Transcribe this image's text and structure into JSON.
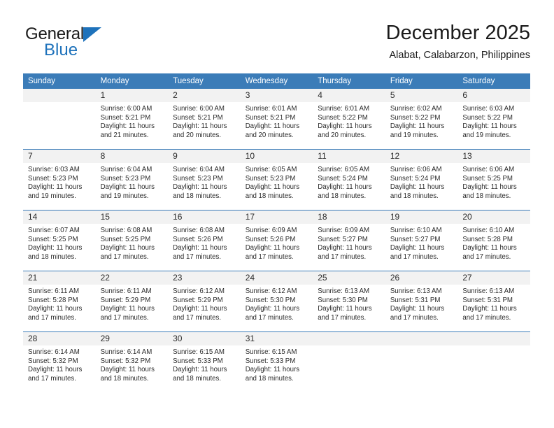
{
  "brand": {
    "name_top": "General",
    "name_bottom": "Blue",
    "accent_color": "#1e72bb",
    "triangle_icon": "triangle-icon"
  },
  "header": {
    "title": "December 2025",
    "subtitle": "Alabat, Calabarzon, Philippines"
  },
  "theme": {
    "header_bg": "#3b7cb8",
    "daynum_bg": "#f2f2f2",
    "row_divider": "#3b7cb8",
    "text": "#2b2b2b"
  },
  "weekdays": [
    "Sunday",
    "Monday",
    "Tuesday",
    "Wednesday",
    "Thursday",
    "Friday",
    "Saturday"
  ],
  "weeks": [
    [
      {
        "day": "",
        "lines": [
          "",
          "",
          "",
          ""
        ]
      },
      {
        "day": "1",
        "lines": [
          "Sunrise: 6:00 AM",
          "Sunset: 5:21 PM",
          "Daylight: 11 hours",
          "and 21 minutes."
        ]
      },
      {
        "day": "2",
        "lines": [
          "Sunrise: 6:00 AM",
          "Sunset: 5:21 PM",
          "Daylight: 11 hours",
          "and 20 minutes."
        ]
      },
      {
        "day": "3",
        "lines": [
          "Sunrise: 6:01 AM",
          "Sunset: 5:21 PM",
          "Daylight: 11 hours",
          "and 20 minutes."
        ]
      },
      {
        "day": "4",
        "lines": [
          "Sunrise: 6:01 AM",
          "Sunset: 5:22 PM",
          "Daylight: 11 hours",
          "and 20 minutes."
        ]
      },
      {
        "day": "5",
        "lines": [
          "Sunrise: 6:02 AM",
          "Sunset: 5:22 PM",
          "Daylight: 11 hours",
          "and 19 minutes."
        ]
      },
      {
        "day": "6",
        "lines": [
          "Sunrise: 6:03 AM",
          "Sunset: 5:22 PM",
          "Daylight: 11 hours",
          "and 19 minutes."
        ]
      }
    ],
    [
      {
        "day": "7",
        "lines": [
          "Sunrise: 6:03 AM",
          "Sunset: 5:23 PM",
          "Daylight: 11 hours",
          "and 19 minutes."
        ]
      },
      {
        "day": "8",
        "lines": [
          "Sunrise: 6:04 AM",
          "Sunset: 5:23 PM",
          "Daylight: 11 hours",
          "and 19 minutes."
        ]
      },
      {
        "day": "9",
        "lines": [
          "Sunrise: 6:04 AM",
          "Sunset: 5:23 PM",
          "Daylight: 11 hours",
          "and 18 minutes."
        ]
      },
      {
        "day": "10",
        "lines": [
          "Sunrise: 6:05 AM",
          "Sunset: 5:23 PM",
          "Daylight: 11 hours",
          "and 18 minutes."
        ]
      },
      {
        "day": "11",
        "lines": [
          "Sunrise: 6:05 AM",
          "Sunset: 5:24 PM",
          "Daylight: 11 hours",
          "and 18 minutes."
        ]
      },
      {
        "day": "12",
        "lines": [
          "Sunrise: 6:06 AM",
          "Sunset: 5:24 PM",
          "Daylight: 11 hours",
          "and 18 minutes."
        ]
      },
      {
        "day": "13",
        "lines": [
          "Sunrise: 6:06 AM",
          "Sunset: 5:25 PM",
          "Daylight: 11 hours",
          "and 18 minutes."
        ]
      }
    ],
    [
      {
        "day": "14",
        "lines": [
          "Sunrise: 6:07 AM",
          "Sunset: 5:25 PM",
          "Daylight: 11 hours",
          "and 18 minutes."
        ]
      },
      {
        "day": "15",
        "lines": [
          "Sunrise: 6:08 AM",
          "Sunset: 5:25 PM",
          "Daylight: 11 hours",
          "and 17 minutes."
        ]
      },
      {
        "day": "16",
        "lines": [
          "Sunrise: 6:08 AM",
          "Sunset: 5:26 PM",
          "Daylight: 11 hours",
          "and 17 minutes."
        ]
      },
      {
        "day": "17",
        "lines": [
          "Sunrise: 6:09 AM",
          "Sunset: 5:26 PM",
          "Daylight: 11 hours",
          "and 17 minutes."
        ]
      },
      {
        "day": "18",
        "lines": [
          "Sunrise: 6:09 AM",
          "Sunset: 5:27 PM",
          "Daylight: 11 hours",
          "and 17 minutes."
        ]
      },
      {
        "day": "19",
        "lines": [
          "Sunrise: 6:10 AM",
          "Sunset: 5:27 PM",
          "Daylight: 11 hours",
          "and 17 minutes."
        ]
      },
      {
        "day": "20",
        "lines": [
          "Sunrise: 6:10 AM",
          "Sunset: 5:28 PM",
          "Daylight: 11 hours",
          "and 17 minutes."
        ]
      }
    ],
    [
      {
        "day": "21",
        "lines": [
          "Sunrise: 6:11 AM",
          "Sunset: 5:28 PM",
          "Daylight: 11 hours",
          "and 17 minutes."
        ]
      },
      {
        "day": "22",
        "lines": [
          "Sunrise: 6:11 AM",
          "Sunset: 5:29 PM",
          "Daylight: 11 hours",
          "and 17 minutes."
        ]
      },
      {
        "day": "23",
        "lines": [
          "Sunrise: 6:12 AM",
          "Sunset: 5:29 PM",
          "Daylight: 11 hours",
          "and 17 minutes."
        ]
      },
      {
        "day": "24",
        "lines": [
          "Sunrise: 6:12 AM",
          "Sunset: 5:30 PM",
          "Daylight: 11 hours",
          "and 17 minutes."
        ]
      },
      {
        "day": "25",
        "lines": [
          "Sunrise: 6:13 AM",
          "Sunset: 5:30 PM",
          "Daylight: 11 hours",
          "and 17 minutes."
        ]
      },
      {
        "day": "26",
        "lines": [
          "Sunrise: 6:13 AM",
          "Sunset: 5:31 PM",
          "Daylight: 11 hours",
          "and 17 minutes."
        ]
      },
      {
        "day": "27",
        "lines": [
          "Sunrise: 6:13 AM",
          "Sunset: 5:31 PM",
          "Daylight: 11 hours",
          "and 17 minutes."
        ]
      }
    ],
    [
      {
        "day": "28",
        "lines": [
          "Sunrise: 6:14 AM",
          "Sunset: 5:32 PM",
          "Daylight: 11 hours",
          "and 17 minutes."
        ]
      },
      {
        "day": "29",
        "lines": [
          "Sunrise: 6:14 AM",
          "Sunset: 5:32 PM",
          "Daylight: 11 hours",
          "and 18 minutes."
        ]
      },
      {
        "day": "30",
        "lines": [
          "Sunrise: 6:15 AM",
          "Sunset: 5:33 PM",
          "Daylight: 11 hours",
          "and 18 minutes."
        ]
      },
      {
        "day": "31",
        "lines": [
          "Sunrise: 6:15 AM",
          "Sunset: 5:33 PM",
          "Daylight: 11 hours",
          "and 18 minutes."
        ]
      },
      {
        "day": "",
        "lines": [
          "",
          "",
          "",
          ""
        ]
      },
      {
        "day": "",
        "lines": [
          "",
          "",
          "",
          ""
        ]
      },
      {
        "day": "",
        "lines": [
          "",
          "",
          "",
          ""
        ]
      }
    ]
  ]
}
